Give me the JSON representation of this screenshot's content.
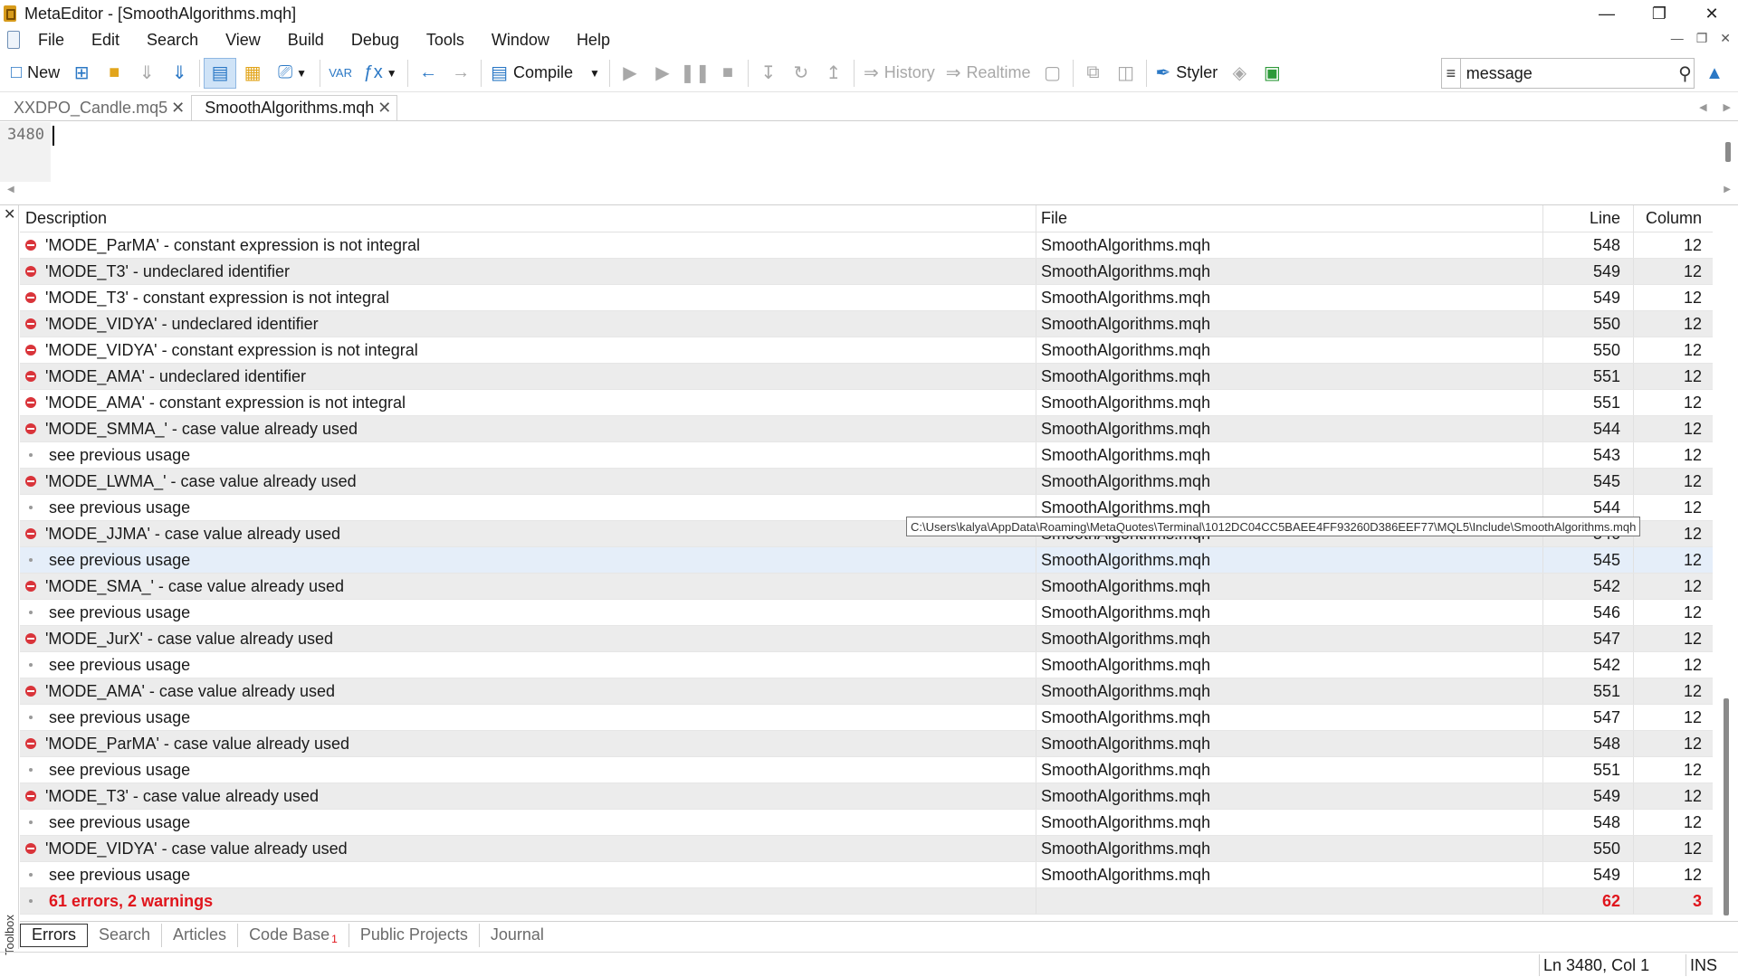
{
  "window": {
    "title": "MetaEditor - [SmoothAlgorithms.mqh]"
  },
  "menu": [
    "File",
    "Edit",
    "Search",
    "View",
    "Build",
    "Debug",
    "Tools",
    "Window",
    "Help"
  ],
  "toolbar": {
    "new_label": "New",
    "compile_label": "Compile",
    "history_label": "History",
    "realtime_label": "Realtime",
    "styler_label": "Styler",
    "search_value": "message"
  },
  "tabs": [
    {
      "label": "XXDPO_Candle.mq5"
    },
    {
      "label": "SmoothAlgorithms.mqh"
    }
  ],
  "editor": {
    "line_number": "3480"
  },
  "errors": {
    "headers": {
      "description": "Description",
      "file": "File",
      "line": "Line",
      "column": "Column"
    },
    "rows": [
      {
        "type": "error",
        "description": "'MODE_ParMA' - constant expression is not integral",
        "file": "SmoothAlgorithms.mqh",
        "line": "548",
        "column": "12"
      },
      {
        "type": "error",
        "description": "'MODE_T3' - undeclared identifier",
        "file": "SmoothAlgorithms.mqh",
        "line": "549",
        "column": "12"
      },
      {
        "type": "error",
        "description": "'MODE_T3' - constant expression is not integral",
        "file": "SmoothAlgorithms.mqh",
        "line": "549",
        "column": "12"
      },
      {
        "type": "error",
        "description": "'MODE_VIDYA' - undeclared identifier",
        "file": "SmoothAlgorithms.mqh",
        "line": "550",
        "column": "12"
      },
      {
        "type": "error",
        "description": "'MODE_VIDYA' - constant expression is not integral",
        "file": "SmoothAlgorithms.mqh",
        "line": "550",
        "column": "12"
      },
      {
        "type": "error",
        "description": "'MODE_AMA' - undeclared identifier",
        "file": "SmoothAlgorithms.mqh",
        "line": "551",
        "column": "12"
      },
      {
        "type": "error",
        "description": "'MODE_AMA' - constant expression is not integral",
        "file": "SmoothAlgorithms.mqh",
        "line": "551",
        "column": "12"
      },
      {
        "type": "error",
        "description": "'MODE_SMMA_' - case value already used",
        "file": "SmoothAlgorithms.mqh",
        "line": "544",
        "column": "12"
      },
      {
        "type": "info",
        "description": "see previous usage",
        "file": "SmoothAlgorithms.mqh",
        "line": "543",
        "column": "12"
      },
      {
        "type": "error",
        "description": "'MODE_LWMA_' - case value already used",
        "file": "SmoothAlgorithms.mqh",
        "line": "545",
        "column": "12"
      },
      {
        "type": "info",
        "description": "see previous usage",
        "file": "SmoothAlgorithms.mqh",
        "line": "544",
        "column": "12"
      },
      {
        "type": "error",
        "description": "'MODE_JJMA' - case value already used",
        "file": "SmoothAlgorithms.mqh",
        "line": "546",
        "column": "12"
      },
      {
        "type": "info",
        "description": "see previous usage",
        "file": "SmoothAlgorithms.mqh",
        "line": "545",
        "column": "12",
        "selected": true
      },
      {
        "type": "error",
        "description": "'MODE_SMA_' - case value already used",
        "file": "SmoothAlgorithms.mqh",
        "line": "542",
        "column": "12"
      },
      {
        "type": "info",
        "description": "see previous usage",
        "file": "SmoothAlgorithms.mqh",
        "line": "546",
        "column": "12"
      },
      {
        "type": "error",
        "description": "'MODE_JurX' - case value already used",
        "file": "SmoothAlgorithms.mqh",
        "line": "547",
        "column": "12"
      },
      {
        "type": "info",
        "description": "see previous usage",
        "file": "SmoothAlgorithms.mqh",
        "line": "542",
        "column": "12"
      },
      {
        "type": "error",
        "description": "'MODE_AMA' - case value already used",
        "file": "SmoothAlgorithms.mqh",
        "line": "551",
        "column": "12"
      },
      {
        "type": "info",
        "description": "see previous usage",
        "file": "SmoothAlgorithms.mqh",
        "line": "547",
        "column": "12"
      },
      {
        "type": "error",
        "description": "'MODE_ParMA' - case value already used",
        "file": "SmoothAlgorithms.mqh",
        "line": "548",
        "column": "12"
      },
      {
        "type": "info",
        "description": "see previous usage",
        "file": "SmoothAlgorithms.mqh",
        "line": "551",
        "column": "12"
      },
      {
        "type": "error",
        "description": "'MODE_T3' - case value already used",
        "file": "SmoothAlgorithms.mqh",
        "line": "549",
        "column": "12"
      },
      {
        "type": "info",
        "description": "see previous usage",
        "file": "SmoothAlgorithms.mqh",
        "line": "548",
        "column": "12"
      },
      {
        "type": "error",
        "description": "'MODE_VIDYA' - case value already used",
        "file": "SmoothAlgorithms.mqh",
        "line": "550",
        "column": "12"
      },
      {
        "type": "info",
        "description": "see previous usage",
        "file": "SmoothAlgorithms.mqh",
        "line": "549",
        "column": "12"
      }
    ],
    "summary": {
      "description": "61 errors, 2 warnings",
      "file": "",
      "line": "62",
      "column": "3"
    }
  },
  "tooltip": "C:\\Users\\kalya\\AppData\\Roaming\\MetaQuotes\\Terminal\\1012DC04CC5BAEE4FF93260D386EEF77\\MQL5\\Include\\SmoothAlgorithms.mqh",
  "toolbox": {
    "label": "Toolbox",
    "tabs": [
      {
        "label": "Errors"
      },
      {
        "label": "Search"
      },
      {
        "label": "Articles"
      },
      {
        "label": "Code Base",
        "badge": "1"
      },
      {
        "label": "Public Projects"
      },
      {
        "label": "Journal"
      }
    ]
  },
  "status": {
    "position": "Ln 3480, Col 1",
    "mode": "INS"
  },
  "colors": {
    "error": "#d9343a",
    "summary": "#e0151c",
    "accent": "#2b78c5"
  }
}
